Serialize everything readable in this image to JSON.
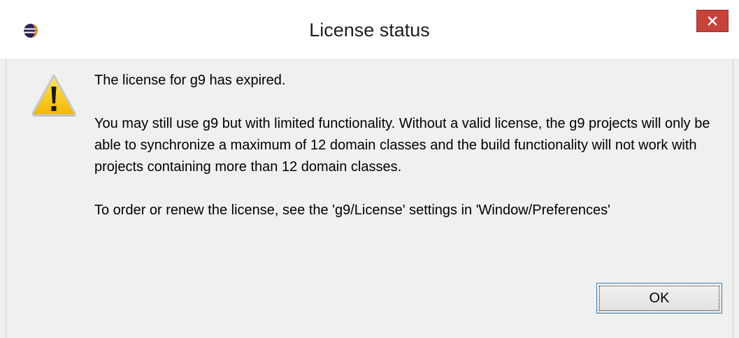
{
  "window": {
    "title": "License status",
    "close_label": "✕"
  },
  "icons": {
    "app": "eclipse-icon",
    "message": "warning-icon",
    "close": "close-icon"
  },
  "colors": {
    "close_button": "#c7423b",
    "warning_yellow": "#f6c400",
    "focus_border": "#3c7fb1"
  },
  "message": {
    "line1": "The license for g9 has expired.",
    "line2": "You may still use g9 but with limited functionality. Without a valid license, the g9 projects will only be able to synchronize a maximum of 12 domain classes and the build functionality will not work with projects containing more than 12 domain classes.",
    "line3": "To order or renew the license, see the 'g9/License' settings in 'Window/Preferences'"
  },
  "buttons": {
    "ok_label": "OK"
  }
}
